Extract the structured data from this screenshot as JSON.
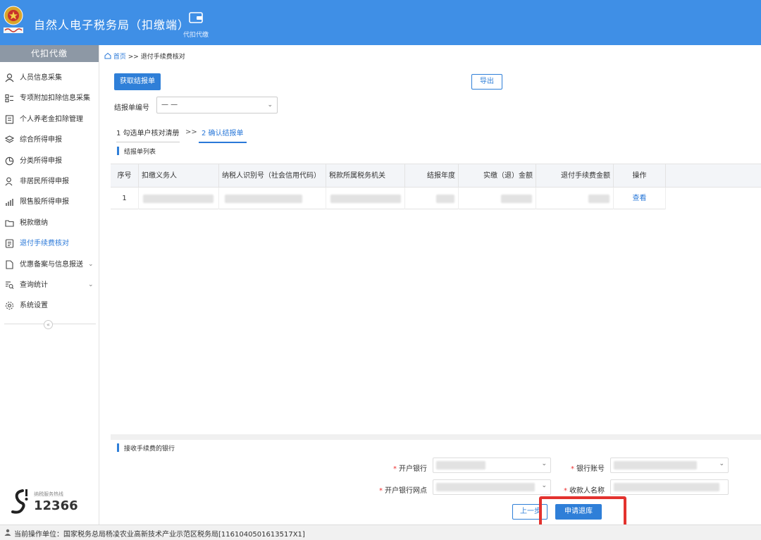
{
  "header": {
    "app_title": "自然人电子税务局（扣缴端）",
    "module_label": "代扣代缴"
  },
  "sidebar": {
    "title": "代扣代缴",
    "items": [
      {
        "label": "人员信息采集",
        "icon": "person-icon",
        "active": false
      },
      {
        "label": "专项附加扣除信息采集",
        "icon": "list-icon",
        "active": false
      },
      {
        "label": "个人养老金扣除管理",
        "icon": "document-icon",
        "active": false
      },
      {
        "label": "综合所得申报",
        "icon": "layers-icon",
        "active": false
      },
      {
        "label": "分类所得申报",
        "icon": "pie-icon",
        "active": false
      },
      {
        "label": "非居民所得申报",
        "icon": "user-outline-icon",
        "active": false
      },
      {
        "label": "限售股所得申报",
        "icon": "bar-chart-icon",
        "active": false
      },
      {
        "label": "税款缴纳",
        "icon": "folder-icon",
        "active": false
      },
      {
        "label": "退付手续费核对",
        "icon": "form-icon",
        "active": true
      },
      {
        "label": "优惠备案与信息报送",
        "icon": "file-icon",
        "active": false,
        "has_submenu": true
      },
      {
        "label": "查询统计",
        "icon": "search-list-icon",
        "active": false,
        "has_submenu": true
      },
      {
        "label": "系统设置",
        "icon": "gear-icon",
        "active": false
      }
    ],
    "hotline_label": "纳税服务热线",
    "hotline_number": "12366"
  },
  "breadcrumb": {
    "home": "首页",
    "separator": ">>",
    "current": "退付手续费核对"
  },
  "toolbar": {
    "fetch_button": "获取结报单",
    "export_button": "导出"
  },
  "report_select": {
    "label": "结报单编号",
    "value": "— —"
  },
  "steps": {
    "step1": "1 勾选单户核对清册",
    "separator": ">>",
    "step2": "2 确认结报单"
  },
  "list_section_title": "结报单列表",
  "table": {
    "columns": [
      "序号",
      "扣缴义务人",
      "纳税人识别号（社会信用代码）",
      "税款所属税务机关",
      "结报年度",
      "实缴（退）金额",
      "退付手续费金额",
      "操作"
    ],
    "rows": [
      {
        "index": "1",
        "action": "查看"
      }
    ]
  },
  "bank_section_title": "接收手续费的银行",
  "bank_form": {
    "required_mark": "*",
    "bank_label": "开户银行",
    "account_label": "银行账号",
    "branch_label": "开户银行网点",
    "payee_label": "收款人名称"
  },
  "actions": {
    "prev_button": "上一步",
    "apply_button": "申请退库"
  },
  "footer": {
    "text": "当前操作单位：国家税务总局杨凌农业高新技术产业示范区税务局[1161040501613517X1]"
  },
  "colors": {
    "header_blue": "#3f8fe6",
    "primary": "#2f7fd8",
    "highlight_red": "#e3322e"
  }
}
